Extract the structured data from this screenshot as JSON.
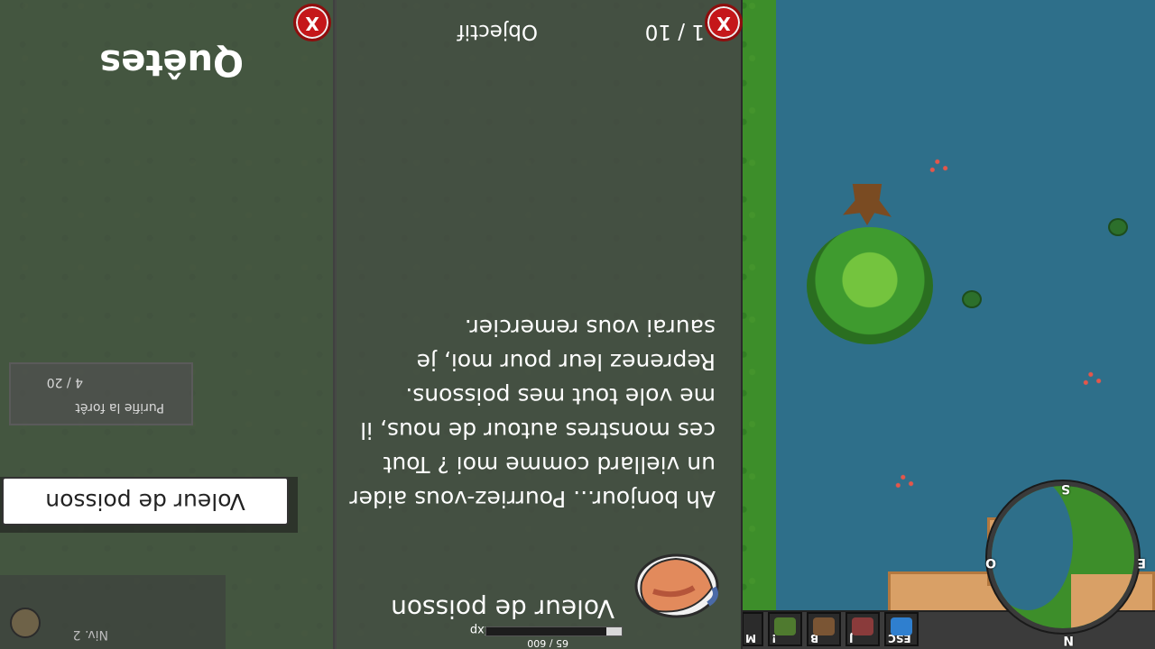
{
  "hud": {
    "exp_label": "Exp",
    "exp_value": "65 / 600",
    "exp_fraction": 0.11,
    "level": "Niv. 2",
    "hotkeys": [
      {
        "key": "ESC",
        "name": "menu-icon",
        "color": "#2f7fcf"
      },
      {
        "key": "J",
        "name": "journal-icon",
        "color": "#8a3b3b"
      },
      {
        "key": "B",
        "name": "bag-icon",
        "color": "#7a5534"
      },
      {
        "key": "!",
        "name": "quest-icon",
        "color": "#4f7a2f"
      },
      {
        "key": "M",
        "name": "map-icon",
        "color": "#a98c5d"
      }
    ],
    "left_keys": [
      "X",
      "B"
    ]
  },
  "dialog": {
    "close_label": "X",
    "title": "Voleur de poisson",
    "body": "Ah bonjour... Pourriez-vous aider un viellard comme moi ? Tout ces monstres autour de nous, il me vole tout mes poissons. Reprenez leur pour moi, je saurai vous remercier.",
    "objective_label": "Objectif",
    "objective_value": "1 / 10"
  },
  "quests": {
    "title": "Quêtes",
    "close_label": "X",
    "active_quest": "Voleur de poisson",
    "other_quest_name": "Purifie la forêt",
    "other_quest_count": "4 / 20"
  },
  "minimap": {
    "north": "N",
    "south": "S",
    "east": "E",
    "west": "O"
  }
}
